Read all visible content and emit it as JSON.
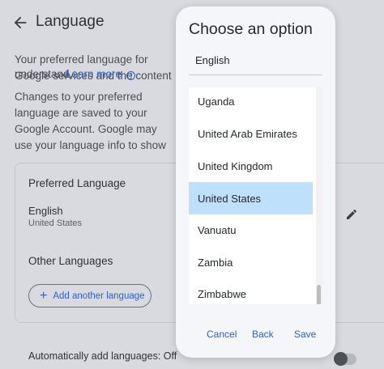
{
  "page": {
    "title": "Language",
    "intro": "Your preferred language for Google services and the content you can understand.",
    "learn_more": "Learn more",
    "changes": "Changes to your preferred language are saved to your Google Account. Google may use your language info to show you more relevant content across Google services. To change the preferred language for your device, go to the language settings on your device.",
    "preferred_heading": "Preferred Language",
    "preferred_language": "English",
    "preferred_region": "United States",
    "other_heading": "Other Languages",
    "add_button": "Add another language",
    "auto_add": "Automatically add languages: Off"
  },
  "dialog": {
    "title": "Choose an option",
    "current_value": "English",
    "options": [
      {
        "label": "Uganda",
        "selected": false
      },
      {
        "label": "United Arab Emirates",
        "selected": false
      },
      {
        "label": "United Kingdom",
        "selected": false
      },
      {
        "label": "United States",
        "selected": true
      },
      {
        "label": "Vanuatu",
        "selected": false
      },
      {
        "label": "Zambia",
        "selected": false
      },
      {
        "label": "Zimbabwe",
        "selected": false
      }
    ],
    "cancel": "Cancel",
    "back": "Back",
    "save": "Save"
  },
  "colors": {
    "accent": "#2f62c4",
    "selected_bg": "#bfe0fa",
    "scrim_bg": "#d8dadf"
  },
  "icons": [
    "back-arrow-icon",
    "info-icon",
    "edit-pencil-icon",
    "plus-icon"
  ]
}
